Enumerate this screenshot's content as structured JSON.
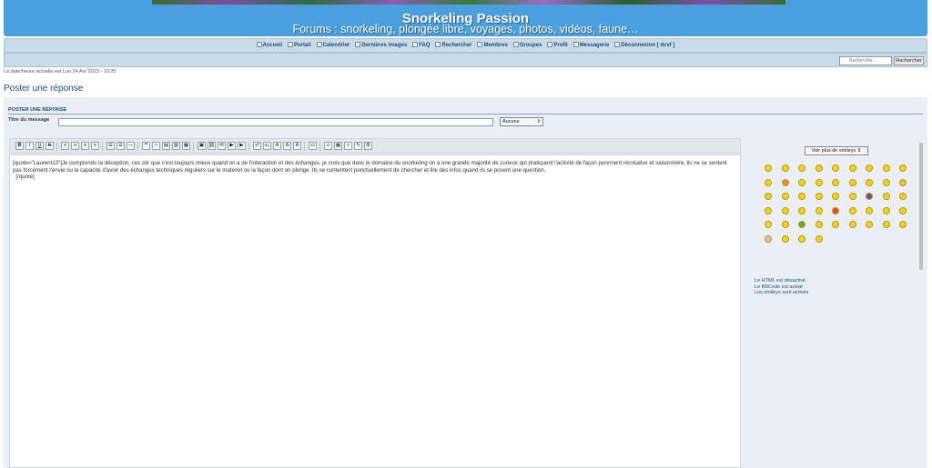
{
  "header": {
    "title": "Snorkeling Passion",
    "subtitle": "Forums : snorkeling, plongée libre, voyages, photos, vidéos, faune…"
  },
  "nav": {
    "items": [
      {
        "label": "Accueil",
        "icon": "home-icon"
      },
      {
        "label": "Portail",
        "icon": "portal-icon"
      },
      {
        "label": "Calendrier",
        "icon": "calendar-icon"
      },
      {
        "label": "Dernières images",
        "icon": "images-icon"
      },
      {
        "label": "FAQ",
        "icon": "help-icon"
      },
      {
        "label": "Rechercher",
        "icon": "search-icon"
      },
      {
        "label": "Membres",
        "icon": "members-icon"
      },
      {
        "label": "Groupes",
        "icon": "groups-icon"
      },
      {
        "label": "Profil",
        "icon": "profile-icon"
      },
      {
        "label": "Messagerie",
        "icon": "mail-icon"
      },
      {
        "label": "Déconnexion [ dcvf ]",
        "icon": "logout-icon"
      }
    ]
  },
  "search": {
    "placeholder": "Rechercher...",
    "button_label": "Rechercher"
  },
  "datetime": "La date/heure actuelle est Lun 24 Avr 2023 - 10:25",
  "page_title": "Poster une réponse",
  "form": {
    "section_title": "POSTER UNE RÉPONSE",
    "subject_label": "Titre du message",
    "subject_value": "",
    "icon_select_value": "Aucune"
  },
  "toolbar": {
    "buttons": [
      {
        "icon": "bold-icon",
        "glyph": "B"
      },
      {
        "icon": "italic-icon",
        "glyph": "I"
      },
      {
        "icon": "underline-icon",
        "glyph": "U"
      },
      {
        "icon": "strike-icon",
        "glyph": "S"
      },
      {
        "icon": "align-left-icon",
        "glyph": "≡"
      },
      {
        "icon": "align-center-icon",
        "glyph": "≡"
      },
      {
        "icon": "align-right-icon",
        "glyph": "≡"
      },
      {
        "icon": "align-justify-icon",
        "glyph": "≡"
      },
      {
        "icon": "bullet-list-icon",
        "glyph": "☰"
      },
      {
        "icon": "number-list-icon",
        "glyph": "☰"
      },
      {
        "icon": "hr-icon",
        "glyph": "―"
      },
      {
        "icon": "quote-icon",
        "glyph": "❝"
      },
      {
        "icon": "code-icon",
        "glyph": "‹›"
      },
      {
        "icon": "spoiler-icon",
        "glyph": "▤"
      },
      {
        "icon": "hide-icon",
        "glyph": "▥"
      },
      {
        "icon": "table-icon",
        "glyph": "▦"
      },
      {
        "icon": "image-icon",
        "glyph": "▣"
      },
      {
        "icon": "link-icon",
        "glyph": "⛓"
      },
      {
        "icon": "email-icon",
        "glyph": "✉"
      },
      {
        "icon": "flash-icon",
        "glyph": "▶"
      },
      {
        "icon": "youtube-icon",
        "glyph": "▶"
      },
      {
        "icon": "superscript-icon",
        "glyph": "x²"
      },
      {
        "icon": "subscript-icon",
        "glyph": "x₂"
      },
      {
        "icon": "font-size-icon",
        "glyph": "A"
      },
      {
        "icon": "font-color-icon",
        "glyph": "A"
      },
      {
        "icon": "font-face-icon",
        "glyph": "A"
      },
      {
        "icon": "fullscreen-icon",
        "glyph": "▭"
      },
      {
        "icon": "smiley-icon",
        "glyph": "☺"
      },
      {
        "icon": "date-icon",
        "glyph": "▦"
      },
      {
        "icon": "preview-icon",
        "glyph": "⌕"
      },
      {
        "icon": "other-icon",
        "glyph": "✎"
      },
      {
        "icon": "source-icon",
        "glyph": "⚙"
      }
    ]
  },
  "editor": {
    "content": "[quote=\"Laurent13\"]Je comprends ta déception, ces sûr que c'est toujours mieux quand on a de l'interaction et des échanges. je crois que dans le domaine du snorkeling on a une grande majorité de curieux qui pratiquent l'activité de façon purement récréative et saisonnière, ils ne se sentent pas forcément l'envie ou la capacité d'avoir des échanges techniques réguliers sur le matériel ou la façon dont on plonge. Ils se contentent ponctuellement de chercher et lire des infos quand ils se posent une question.\n  [/quote]"
  },
  "smileys": {
    "select_label": "Voir plus de smileys",
    "count": 49,
    "colors": [
      "#f7d21c",
      "#f08a3e",
      "#e8c14a",
      "#6a4bb8",
      "#e24b3b",
      "#5aa84a",
      "#f1b0c8",
      "#3b7bd6"
    ]
  },
  "info": {
    "html": "Le HTML est désactivé",
    "bbcode": "Le BBCode est activé",
    "smileys": "Les smileys sont activés"
  },
  "colors": {
    "header_bg": "#4a9fe0",
    "nav_bg": "#c9dbe9",
    "accent_text": "#1d4d7a",
    "panel_bg": "#e9eff4"
  }
}
